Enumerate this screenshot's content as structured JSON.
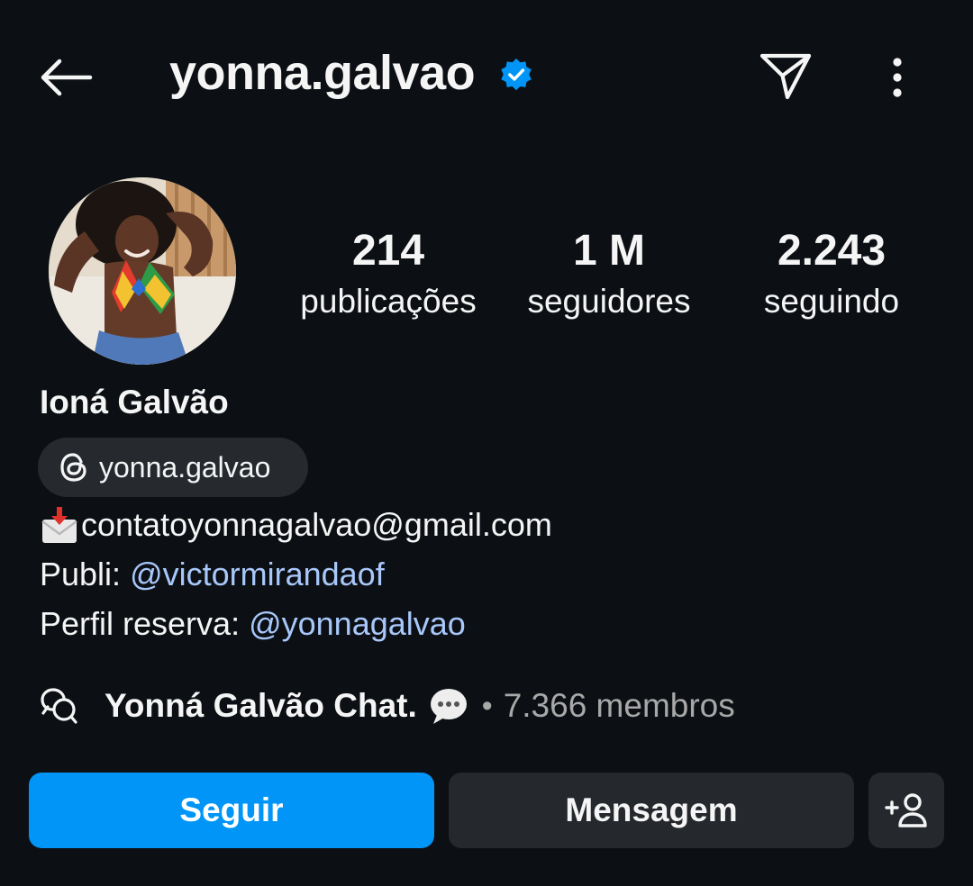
{
  "header": {
    "username": "yonna.galvao",
    "verified": true,
    "icons": {
      "back": "back-arrow-icon",
      "verified": "verified-badge-icon",
      "send": "send-direct-icon",
      "more": "more-vertical-icon"
    }
  },
  "stats": {
    "posts": {
      "value": "214",
      "label": "publicações"
    },
    "followers": {
      "value": "1 M",
      "label": "seguidores"
    },
    "following": {
      "value": "2.243",
      "label": "seguindo"
    }
  },
  "bio": {
    "full_name": "Ioná Galvão",
    "threads_handle": "yonna.galvao",
    "email": "contatoyonnagalvao@gmail.com",
    "publi_prefix": "Publi: ",
    "publi_link": "@victormirandaof",
    "reserva_prefix": "Perfil reserva: ",
    "reserva_link": "@yonnagalvao"
  },
  "chat": {
    "name": "Yonná Galvão Chat.",
    "separator": "•",
    "members": "7.366 membros"
  },
  "actions": {
    "follow": "Seguir",
    "message": "Mensagem"
  },
  "colors": {
    "background": "#0c1014",
    "primary_button": "#0095f6",
    "secondary_button": "#25292e",
    "link": "#a8c7fa",
    "muted_text": "#a8a8a8",
    "verified": "#0095f6"
  }
}
